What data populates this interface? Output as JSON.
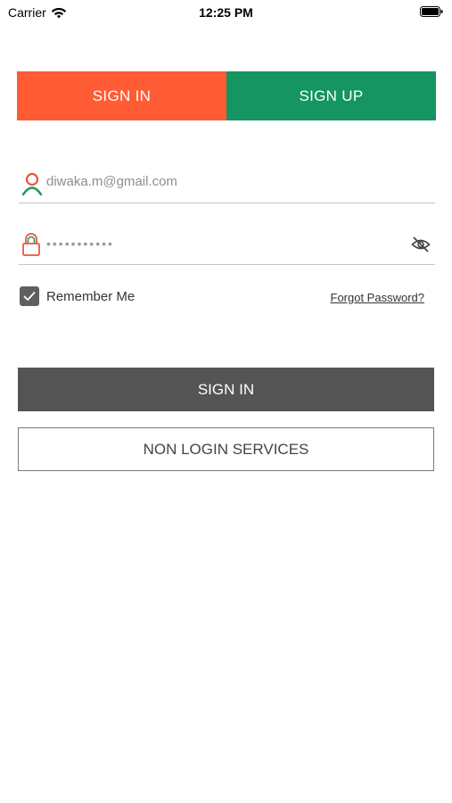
{
  "status_bar": {
    "carrier": "Carrier",
    "time": "12:25 PM"
  },
  "tabs": [
    {
      "label": "SIGN IN",
      "color": "#FF5C35",
      "active": true
    },
    {
      "label": "SIGN UP",
      "color": "#159561",
      "active": false
    }
  ],
  "form": {
    "email_value": "diwaka.m@gmail.com",
    "password_masked": "•••••••••••",
    "user_icon": "user-icon",
    "lock_icon": "lock-icon",
    "eye_icon": "eye-off-icon"
  },
  "remember": {
    "label": "Remember Me",
    "checked": true
  },
  "forgot_label": "Forgot Password?",
  "buttons": {
    "sign_in": "SIGN IN",
    "non_login": "NON LOGIN SERVICES"
  },
  "colors": {
    "dark_button": "#545454",
    "accent_orange": "#FF5C35",
    "accent_green": "#159561"
  }
}
